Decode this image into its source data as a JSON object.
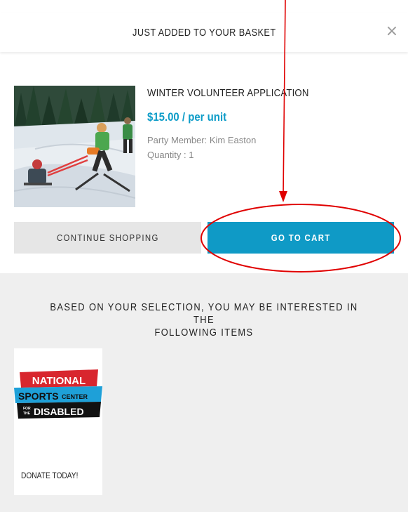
{
  "modal": {
    "title": "JUST ADDED TO YOUR BASKET",
    "close_glyph": "×"
  },
  "product": {
    "name": "WINTER VOLUNTEER APPLICATION",
    "price": "$15.00 / per unit",
    "party_member": "Party Member: Kim Easton",
    "quantity": "Quantity : 1"
  },
  "buttons": {
    "continue_label": "CONTINUE SHOPPING",
    "cart_label": "GO TO CART"
  },
  "recommendations": {
    "heading_line1": "BASED ON YOUR SELECTION, YOU MAY BE INTERESTED IN THE",
    "heading_line2": "FOLLOWING ITEMS",
    "items": [
      {
        "label": "DONATE TODAY!",
        "logo": {
          "line1": "NATIONAL",
          "line2": "SPORTS",
          "line2_small": "CENTER",
          "line3_prefix_top": "FOR",
          "line3_prefix_bottom": "THE",
          "line3": "DISABLED"
        }
      }
    ]
  },
  "colors": {
    "accent": "#0f9ac6",
    "price": "#0d9cc8",
    "annotation": "#e00000",
    "logo_red": "#d8262e",
    "logo_blue": "#1ea0d8",
    "logo_black": "#111111"
  }
}
